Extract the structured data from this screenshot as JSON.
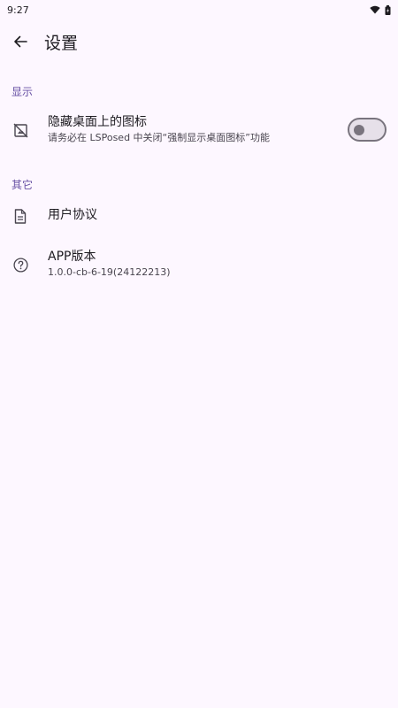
{
  "status_bar": {
    "time": "9:27"
  },
  "header": {
    "title": "设置"
  },
  "sections": [
    {
      "title": "显示",
      "items": [
        {
          "title": "隐藏桌面上的图标",
          "subtitle": "请务必在 LSPosed 中关闭“强制显示桌面图标”功能",
          "switch_on": false,
          "icon": "hide-image-icon"
        }
      ]
    },
    {
      "title": "其它",
      "items": [
        {
          "title": "用户协议",
          "icon": "document-icon"
        },
        {
          "title": "APP版本",
          "subtitle": "1.0.0-cb-6-19(24122213)",
          "icon": "help-circle-icon"
        }
      ]
    }
  ],
  "colors": {
    "background": "#fdf7ff",
    "accent": "#6750a4",
    "switch_outline": "#79747e"
  }
}
